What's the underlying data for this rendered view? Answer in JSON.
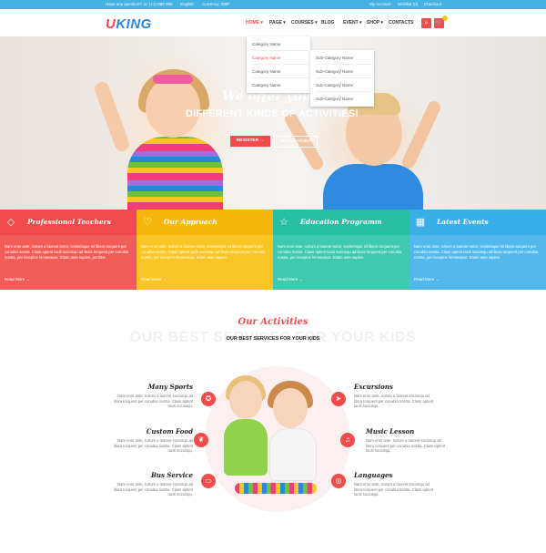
{
  "topbar": {
    "question": "Have any question? ☏ (+1) 888 999",
    "language": "English",
    "currency": "Currency: GBP",
    "my_account": "My Account",
    "wishlist": "Wishlist (0)",
    "checkout": "Checkout"
  },
  "header": {
    "logo_u": "U",
    "logo_rest": "KING",
    "nav": [
      "HOME",
      "PAGE",
      "COURSES",
      "BLOG",
      "EVENT",
      "SHOP",
      "CONTACTS"
    ],
    "search_icon": "search-icon",
    "cart_icon": "cart-icon"
  },
  "dropdown": {
    "items": [
      "Category Name",
      "Category Name",
      "Category Name",
      "Category Name"
    ],
    "sub_items": [
      "Sub-Category Name",
      "Sub-Category Name",
      "Sub-Category Name",
      "Sub-Category Name"
    ]
  },
  "hero": {
    "title_script": "We offer your ch",
    "title_main": "DIFFERENT KINDS OF ACTIVITIES!",
    "register_label": "REGISTER →",
    "watch_label": "WATCH VIDEO"
  },
  "features": [
    {
      "title": "Professional Teachers",
      "icon": "diamond-icon",
      "color": "#f25c57",
      "head_color": "#ef4b4b",
      "desc": "Nam eros ante, rutrum a laoreet tortor, scelerisque sit libero torquent per conubia nostra. Class aptent taciti sociosqu ad litora torquent per conubia nostra, per inceptos himenaeos. Etiam ante sapien, porttitor.",
      "more": "Read More →"
    },
    {
      "title": "Our Approach",
      "icon": "heart-icon",
      "color": "#f8c524",
      "head_color": "#f6b80f",
      "desc": "Nam eros ante, rutrum a laoreet tortor, scelerisque sit libero torquent per conubia nostra. Class aptent taciti sociosqu ad litora torquent per conubia nostra, per inceptos himenaeos. Etiam ante sapien.",
      "more": "Read More →"
    },
    {
      "title": "Education Programm",
      "icon": "star-icon",
      "color": "#3ec9b0",
      "head_color": "#27bea3",
      "desc": "Nam eros ante, rutrum a laoreet tortor, scelerisque sit libero torquent per conubia nostra. Class aptent taciti sociosqu ad litora torquent per conubia nostra, per inceptos himenaeos. Etiam ante sapien.",
      "more": "Read More →"
    },
    {
      "title": "Latest Events",
      "icon": "calendar-icon",
      "color": "#52b8ec",
      "head_color": "#3aaee6",
      "desc": "Nam eros ante, rutrum a laoreet tortor, scelerisque sit libero torquent per conubia nostra. Class aptent taciti sociosqu ad litora torquent per conubia nostra, per inceptos himenaeos. Etiam ante sapien.",
      "more": "Read More →"
    }
  ],
  "activities": {
    "script_title": "Our Activities",
    "bg_text": "OUR BEST SERVICES FOR YOUR KIDS",
    "subtitle": "OUR BEST SERVICES FOR YOUR KIDS",
    "left": [
      {
        "title": "Many Sports",
        "icon": "medal-icon",
        "desc": "Nam eros ante, rutrum a laoreet sociosqu ad litora torquent per conubia nostra. Class aptent taciti sociosqu."
      },
      {
        "title": "Custom Food",
        "icon": "leaf-icon",
        "desc": "Nam eros ante, rutrum a laoreet sociosqu ad litora torquent per conubia nostra. Class aptent taciti sociosqu."
      },
      {
        "title": "Bus Service",
        "icon": "bus-icon",
        "desc": "Nam eros ante, rutrum a laoreet sociosqu ad litora torquent per conubia nostra. Class aptent taciti sociosqu."
      }
    ],
    "right": [
      {
        "title": "Excursions",
        "icon": "plane-icon",
        "desc": "Nam eros ante, rutrum a laoreet sociosqu ad litora torquent per conubia nostra. Class aptent taciti sociosqu."
      },
      {
        "title": "Music Lesson",
        "icon": "headphones-icon",
        "desc": "Nam eros ante, rutrum a laoreet sociosqu ad litora torquent per conubia nostra. Class aptent taciti sociosqu."
      },
      {
        "title": "Languages",
        "icon": "globe-icon",
        "desc": "Nam eros ante, rutrum a laoreet sociosqu ad litora torquent per conubia nostra. Class aptent taciti sociosqu."
      }
    ]
  },
  "colors": {
    "accent": "#f14c4c",
    "topbar": "#44b3e3"
  }
}
